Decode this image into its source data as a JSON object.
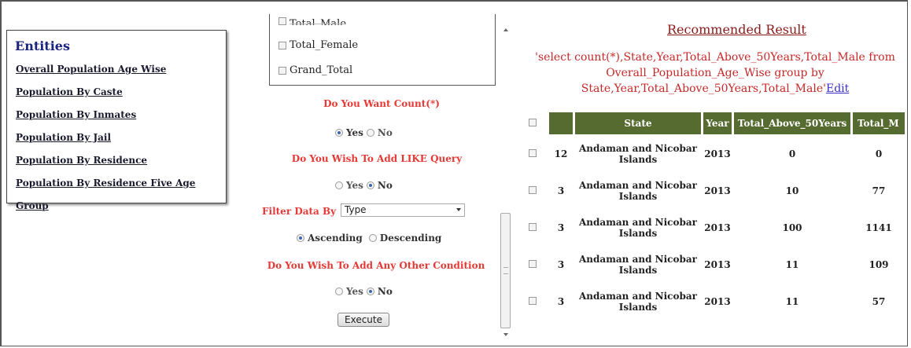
{
  "entities": {
    "title": "Entities",
    "links": [
      "Overall Population Age Wise",
      "Population By Caste",
      "Population By Inmates",
      "Population By Jail",
      "Population By Residence",
      "Population By Residence Five Age Group"
    ]
  },
  "columns_checklist": {
    "partial_item": "Total_Male",
    "items": [
      "Total_Female",
      "Grand_Total"
    ]
  },
  "count_question": {
    "label": "Do You Want Count(*)",
    "yes": "Yes",
    "no": "No",
    "selected": "Yes"
  },
  "like_question": {
    "label": "Do You Wish To Add LIKE Query",
    "yes": "Yes",
    "no": "No",
    "selected": "No"
  },
  "filter": {
    "label": "Filter Data By",
    "selected": "Type"
  },
  "sort": {
    "ascending": "Ascending",
    "descending": "Descending",
    "selected": "Ascending"
  },
  "condition_question": {
    "label": "Do You Wish To Add Any Other Condition",
    "yes": "Yes",
    "no": "No",
    "selected": "No"
  },
  "execute_label": "Execute",
  "result": {
    "title": "Recommended Result",
    "query": "'select count(*),State,Year,Total_Above_50Years,Total_Male from Overall_Population_Age_Wise group by State,Year,Total_Above_50Years,Total_Male'",
    "edit_label": "Edit",
    "headers": [
      "",
      "State",
      "Year",
      "Total_Above_50Years",
      "Total_M"
    ],
    "rows": [
      {
        "count": "12",
        "state": "Andaman and Nicobar Islands",
        "year": "2013",
        "above50": "0",
        "male": "0"
      },
      {
        "count": "3",
        "state": "Andaman and Nicobar Islands",
        "year": "2013",
        "above50": "10",
        "male": "77"
      },
      {
        "count": "3",
        "state": "Andaman and Nicobar Islands",
        "year": "2013",
        "above50": "100",
        "male": "1141"
      },
      {
        "count": "3",
        "state": "Andaman and Nicobar Islands",
        "year": "2013",
        "above50": "11",
        "male": "109"
      },
      {
        "count": "3",
        "state": "Andaman and Nicobar Islands",
        "year": "2013",
        "above50": "11",
        "male": "57"
      }
    ]
  },
  "colors": {
    "header_bg": "#556b2f",
    "question_red": "#e53935",
    "title_maroon": "#8b1a1a"
  }
}
